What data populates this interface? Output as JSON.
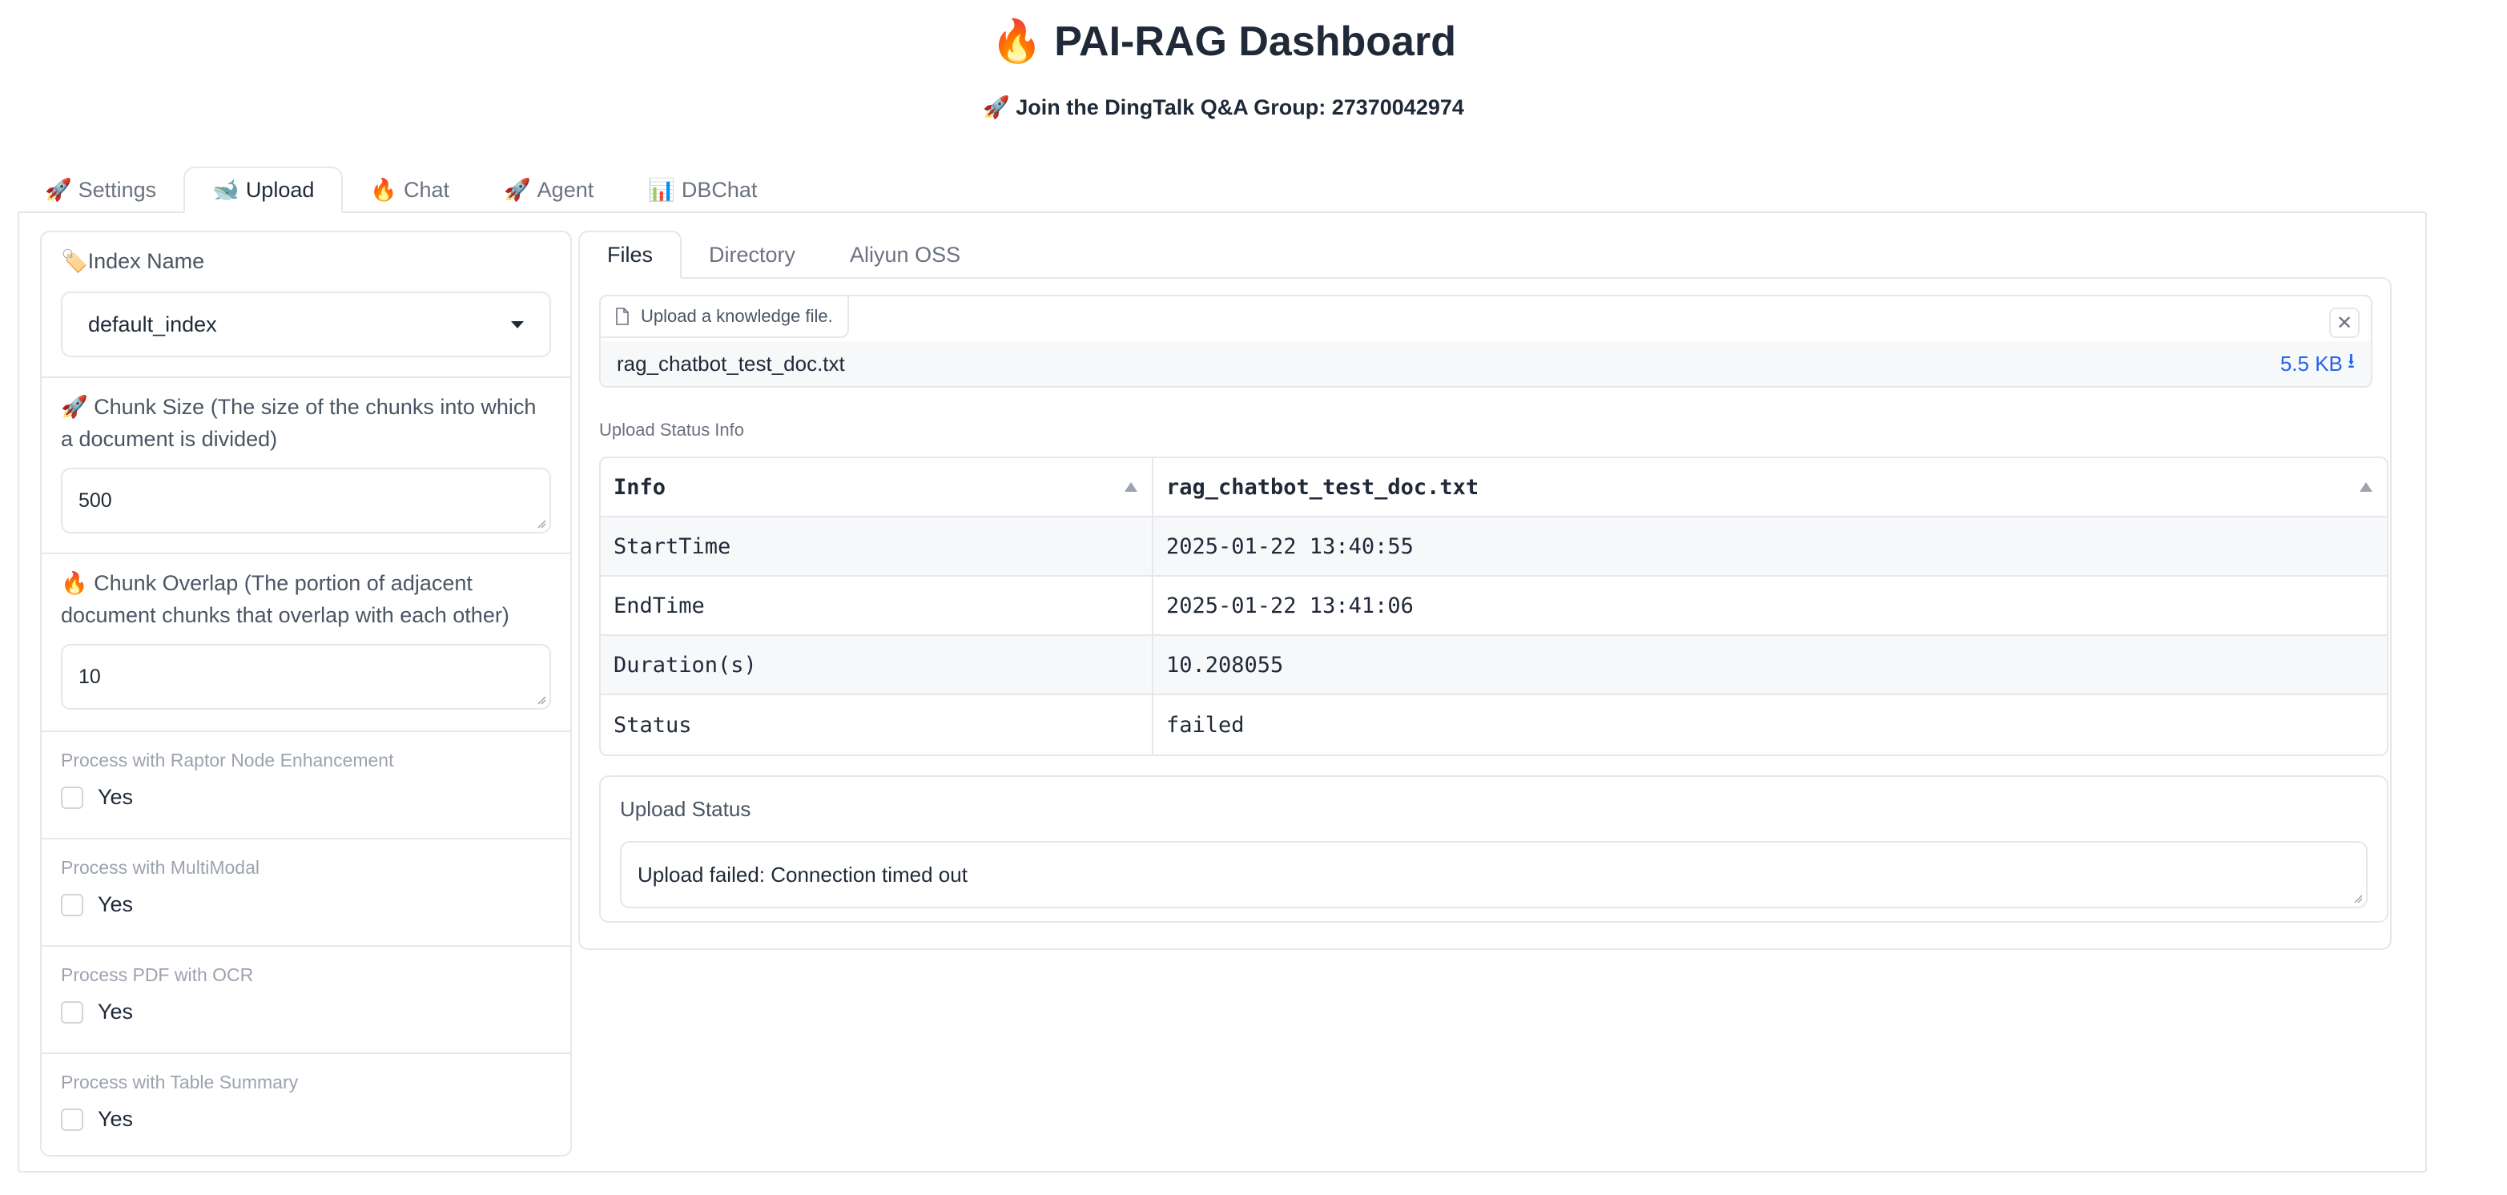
{
  "header": {
    "title": "🔥 PAI-RAG Dashboard",
    "subtitle": "🚀 Join the DingTalk Q&A Group: 27370042974"
  },
  "tabs": [
    {
      "icon": "🚀",
      "label": "Settings"
    },
    {
      "icon": "🐋",
      "label": "Upload"
    },
    {
      "icon": "🔥",
      "label": "Chat"
    },
    {
      "icon": "🚀",
      "label": "Agent"
    },
    {
      "icon": "📊",
      "label": "DBChat"
    }
  ],
  "active_tab": "Upload",
  "left": {
    "index_name_label": "🏷️Index Name",
    "index_name_value": "default_index",
    "chunk_size_label": "🚀 Chunk Size (The size of the chunks into which a document is divided)",
    "chunk_size_value": "500",
    "chunk_overlap_label": "🔥 Chunk Overlap (The portion of adjacent document chunks that overlap with each other)",
    "chunk_overlap_value": "10",
    "options": [
      {
        "label": "Process with Raptor Node Enhancement",
        "check_label": "Yes",
        "checked": false
      },
      {
        "label": "Process with MultiModal",
        "check_label": "Yes",
        "checked": false
      },
      {
        "label": "Process PDF with OCR",
        "check_label": "Yes",
        "checked": false
      },
      {
        "label": "Process with Table Summary",
        "check_label": "Yes",
        "checked": false
      }
    ]
  },
  "right": {
    "sub_tabs": [
      "Files",
      "Directory",
      "Aliyun OSS"
    ],
    "active_sub_tab": "Files",
    "upload_label": "Upload a knowledge file.",
    "file_name": "rag_chatbot_test_doc.txt",
    "file_size": "5.5 KB",
    "status_info_label": "Upload Status Info",
    "table": {
      "headers": [
        "Info",
        "rag_chatbot_test_doc.txt"
      ],
      "rows": [
        [
          "StartTime",
          "2025-01-22 13:40:55"
        ],
        [
          "EndTime",
          "2025-01-22 13:41:06"
        ],
        [
          "Duration(s)",
          "10.208055"
        ],
        [
          "Status",
          "failed"
        ]
      ]
    },
    "upload_status_label": "Upload Status",
    "upload_status_value": "Upload failed: Connection timed out"
  },
  "colors": {
    "border": "#e5e7eb",
    "link_blue": "#2563eb",
    "muted_text": "#9ca3af",
    "row_stripe": "#f7f8fa"
  }
}
